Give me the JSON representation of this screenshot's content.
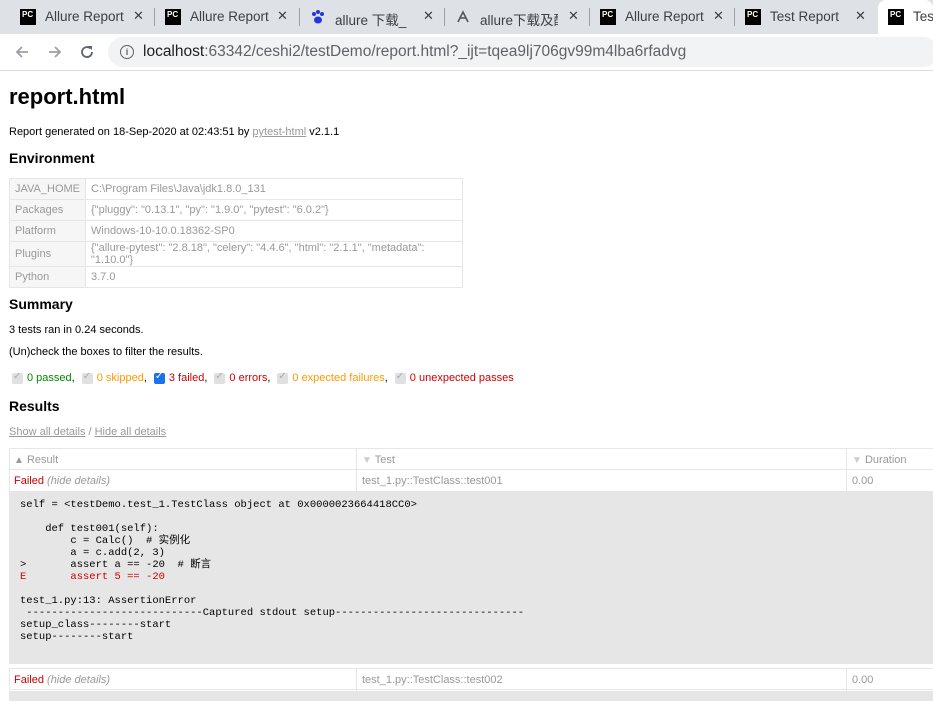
{
  "browser": {
    "tabs": [
      {
        "label": "Allure Report",
        "icon": "pycharm-icon"
      },
      {
        "label": "Allure Report",
        "icon": "pycharm-icon"
      },
      {
        "label": "allure 下载_百度",
        "icon": "baidu-paw-icon"
      },
      {
        "label": "allure下载及配",
        "icon": "allure-icon"
      },
      {
        "label": "Allure Report",
        "icon": "pycharm-icon"
      },
      {
        "label": "Test Report",
        "icon": "pycharm-icon"
      },
      {
        "label": "Test",
        "icon": "pycharm-icon"
      }
    ],
    "url_host": "localhost",
    "url_rest": ":63342/ceshi2/testDemo/report.html?_ijt=tqea9lj706gv99m4lba6rfadvg"
  },
  "report": {
    "title": "report.html",
    "generated_prefix": "Report generated on 18-Sep-2020 at 02:43:51 by ",
    "generated_link": "pytest-html",
    "generated_suffix": " v2.1.1"
  },
  "environment": {
    "heading": "Environment",
    "rows": [
      {
        "key": "JAVA_HOME",
        "value": "C:\\Program Files\\Java\\jdk1.8.0_131"
      },
      {
        "key": "Packages",
        "value": "{\"pluggy\": \"0.13.1\", \"py\": \"1.9.0\", \"pytest\": \"6.0.2\"}"
      },
      {
        "key": "Platform",
        "value": "Windows-10-10.0.18362-SP0"
      },
      {
        "key": "Plugins",
        "value": "{\"allure-pytest\": \"2.8.18\", \"celery\": \"4.4.6\", \"html\": \"2.1.1\", \"metadata\": \"1.10.0\"}"
      },
      {
        "key": "Python",
        "value": "3.7.0"
      }
    ]
  },
  "summary": {
    "heading": "Summary",
    "ran": "3 tests ran in 0.24 seconds.",
    "filter_hint": "(Un)check the boxes to filter the results.",
    "filters": {
      "passed": "0 passed",
      "skipped": "0 skipped",
      "failed": "3 failed",
      "errors": "0 errors",
      "xfail": "0 expected failures",
      "xpass": "0 unexpected passes"
    }
  },
  "results": {
    "heading": "Results",
    "show_all": "Show all details",
    "separator": " / ",
    "hide_all": "Hide all details",
    "columns": {
      "result": "Result",
      "test": "Test",
      "duration": "Duration"
    },
    "rows": [
      {
        "result": "Failed",
        "hide": "(hide details)",
        "test": "test_1.py::TestClass::test001",
        "duration": "0.00"
      },
      {
        "result": "Failed",
        "hide": "(hide details)",
        "test": "test_1.py::TestClass::test002",
        "duration": "0.00"
      }
    ],
    "log": {
      "line1": "self = <testDemo.test_1.TestClass object at 0x0000023664418CC0>",
      "line2": "    def test001(self):",
      "line3": "        c = Calc()  # 实例化",
      "line4": "        a = c.add(2, 3)",
      "line5": ">       assert a == -20  # 断言",
      "line6": "E       assert 5 == -20",
      "line7": "test_1.py:13: AssertionError",
      "line8": " ----------------------------Captured stdout setup------------------------------",
      "line9": "setup_class--------start",
      "line10": "setup--------start"
    }
  }
}
